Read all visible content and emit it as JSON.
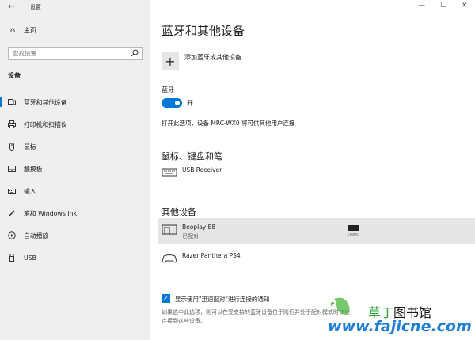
{
  "window": {
    "title": "设置",
    "back_glyph": "←",
    "minimize_glyph": "—",
    "maximize_glyph": "☐",
    "close_glyph": "✕"
  },
  "sidebar": {
    "home_label": "主页",
    "search_placeholder": "查找设置",
    "section_label": "设备",
    "items": [
      {
        "label": "蓝牙和其他设备",
        "icon": "bluetooth-devices-icon",
        "active": true
      },
      {
        "label": "打印机和扫描仪",
        "icon": "printer-icon",
        "active": false
      },
      {
        "label": "鼠标",
        "icon": "mouse-icon",
        "active": false
      },
      {
        "label": "触摸板",
        "icon": "touchpad-icon",
        "active": false
      },
      {
        "label": "输入",
        "icon": "keyboard-icon",
        "active": false
      },
      {
        "label": "笔和 Windows Ink",
        "icon": "pen-icon",
        "active": false
      },
      {
        "label": "自动播放",
        "icon": "autoplay-icon",
        "active": false
      },
      {
        "label": "USB",
        "icon": "usb-icon",
        "active": false
      }
    ]
  },
  "main": {
    "title": "蓝牙和其他设备",
    "add_device_label": "添加蓝牙或其他设备",
    "bluetooth_label": "蓝牙",
    "bluetooth_toggle_state": "开",
    "discoverable_text": "打开此选项，设备 MRC-WX0 将可供其他用户连接",
    "mouse_section": {
      "heading": "鼠标、键盘和笔",
      "devices": [
        {
          "name": "USB Receiver",
          "icon": "keyboard-icon"
        }
      ]
    },
    "other_section": {
      "heading": "其他设备",
      "devices": [
        {
          "name": "Beoplay E8",
          "status": "已配对",
          "battery": "100%",
          "icon": "audio-device-icon"
        },
        {
          "name": "Razer Panthera PS4",
          "icon": "gamepad-icon"
        }
      ]
    },
    "swift_pair_label": "显示使用\"迅速配对\"进行连接的通知",
    "swift_pair_checked": true,
    "swift_pair_desc": "如果选中此选项，则可以在受支持的蓝牙设备位于附近并处于配对模式时快速连接到这些设备。"
  },
  "watermark": {
    "cn_green": "草丁",
    "cn_rest": "图书馆",
    "url": "www.fajicne.com"
  },
  "colors": {
    "accent": "#0078d7",
    "sidebar_bg": "#efefef",
    "selected_row": "#e6e6e6"
  }
}
